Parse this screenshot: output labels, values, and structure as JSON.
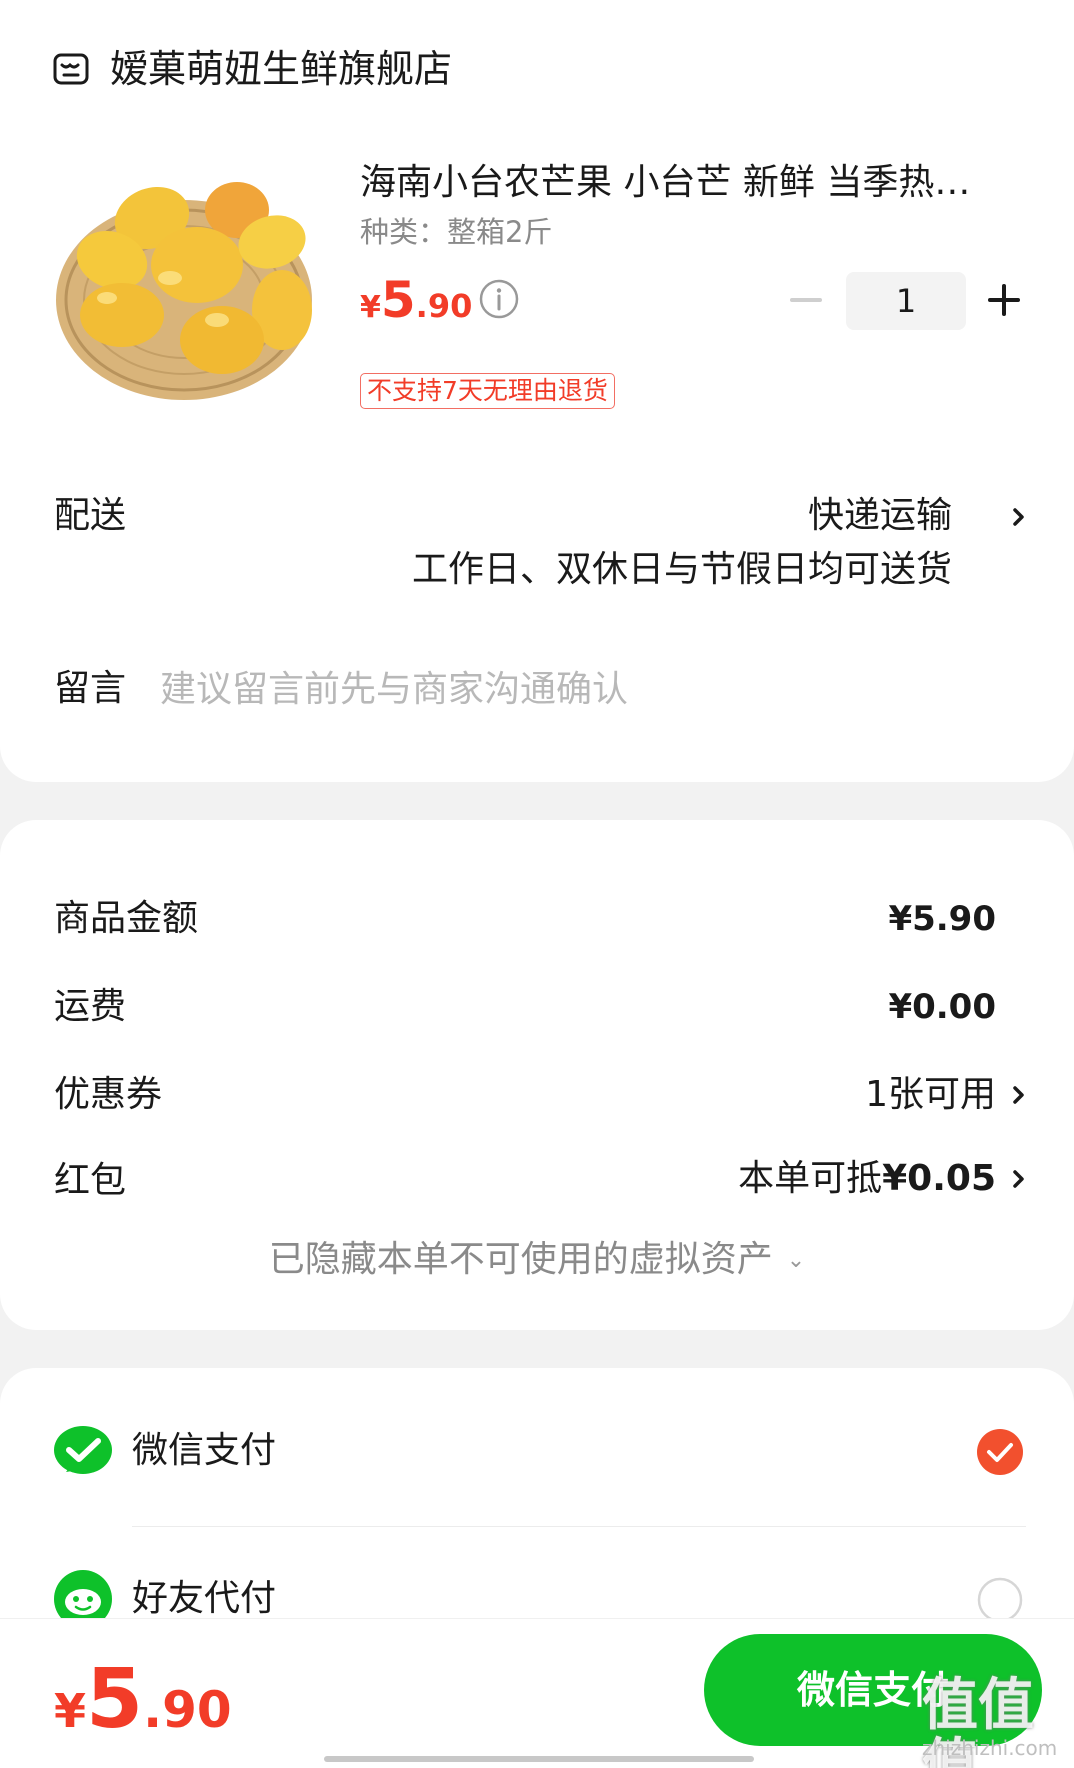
{
  "store": {
    "name": "嫒菓萌妞生鲜旗舰店",
    "icon": "store-icon"
  },
  "product": {
    "title": "海南小台农芒果 小台芒 新鲜 当季热…",
    "spec": "种类：整箱2斤",
    "price_currency": "¥",
    "price_int": "5",
    "price_dec": ".90",
    "quantity": "1",
    "return_policy": "不支持7天无理由退货",
    "image": "mango-basket-image"
  },
  "delivery": {
    "label": "配送",
    "method": "快递运输",
    "note": "工作日、双休日与节假日均可送货"
  },
  "message": {
    "label": "留言",
    "placeholder": "建议留言前先与商家沟通确认"
  },
  "amounts": {
    "goods_label": "商品金额",
    "goods_value": "¥5.90",
    "shipping_label": "运费",
    "shipping_value": "¥0.00",
    "coupon_label": "优惠券",
    "coupon_value": "1张可用",
    "redpacket_label": "红包",
    "redpacket_prefix": "本单可抵",
    "redpacket_amount": "¥0.05",
    "hidden_assets": "已隐藏本单不可使用的虚拟资产"
  },
  "payment": {
    "wechat_label": "微信支付",
    "friend_label": "好友代付",
    "selected": "wechat"
  },
  "footer": {
    "total_currency": "¥",
    "total_int": "5",
    "total_dec": ".90",
    "pay_button": "微信支付"
  },
  "watermark": {
    "main": "值值值",
    "sub": "zhizhizhi.com"
  },
  "colors": {
    "price_red": "#f23c28",
    "wechat_green": "#0ec12a",
    "check_orange": "#f2502e"
  }
}
